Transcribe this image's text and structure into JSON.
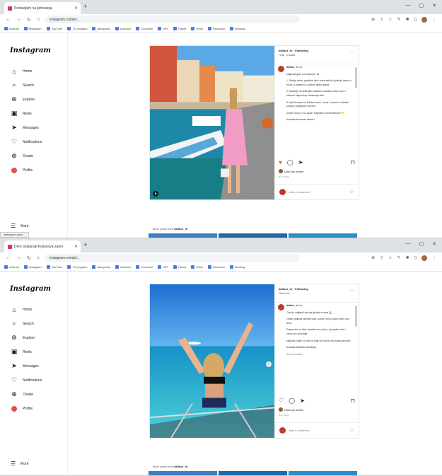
{
  "shots": [
    {
      "tab_title": "Postavljeni sa ljetovanja",
      "url": "instagram.com/p/...",
      "post": {
        "username": "dalibor_hr · Following",
        "location": "Hvar, Croatia",
        "caption_user": "dalibor_hr",
        "caption_time": "1w",
        "caption": [
          "Najljepši grad na Jadranu? 😍",
          "1. Šetnja rivom, gradske ulice pune kafića i jutarnja kava uz more, a posebno u starom dijelu grada.",
          "2. Kupanje na obližnjim plažama, kristalno čisto more i skriveni zaljevi koji oduzimaju dah.",
          "3. Izlet brodom na Pakleni otoci, ručak u konobi i zalazak sunca s pogledom na luku.",
          "Znate li koji je ovo grad? Napišite u komentarima! 👇",
          "#croatia #summer #travel"
        ],
        "likes": "Liked by others",
        "date": "JULY 2022",
        "comment_placeholder": "Add a comment..."
      },
      "more_posts_prefix": "More posts from",
      "more_posts_user": "dalibor_hr"
    },
    {
      "tab_title": "Dom postanak Kokosova zanni",
      "url": "instagram.com/p/...",
      "post": {
        "username": "dalibor_hr · Following",
        "location": "Otok Krk",
        "caption_user": "dalibor_hr",
        "caption_time": "1w",
        "caption": [
          "Otok je najljepši kad ga gledaš s mora 🌊",
          "Ovako izgleda savršen dan: sunce, brod i plavo more oko tebe.",
          "Preporuke za izlet: krenite rano ujutro, ponesite vodu i kremu za sunčanje.",
          "Najbolje uvale su one do kojih se može doći samo brodom.",
          "#croatia #adriatic #boatday",
          "See translation"
        ],
        "likes": "Liked by others",
        "date": "JULY 2022",
        "comment_placeholder": "Add a comment..."
      },
      "more_posts_prefix": "More posts from",
      "more_posts_user": "dalibor_hr"
    }
  ],
  "browser": {
    "new_tab": "+",
    "bookmarks": [
      "Android",
      "Instagram",
      "YouTube",
      "TV program",
      "Aliexpress",
      "Ulaznice",
      "Cromwell",
      "HRT",
      "Planet",
      "Hotel",
      "Facebook",
      "Booking"
    ]
  },
  "sidebar": {
    "logo": "Instagram",
    "items": [
      {
        "label": "Home",
        "icon": "home-icon",
        "glyph": "⌂"
      },
      {
        "label": "Search",
        "icon": "search-icon",
        "glyph": "⌕"
      },
      {
        "label": "Explore",
        "icon": "compass-icon",
        "glyph": "⊛"
      },
      {
        "label": "Reels",
        "icon": "reels-icon",
        "glyph": "▣"
      },
      {
        "label": "Messages",
        "icon": "send-icon",
        "glyph": "➤"
      },
      {
        "label": "Notifications",
        "icon": "heart-icon",
        "glyph": "♡"
      },
      {
        "label": "Create",
        "icon": "plus-icon",
        "glyph": "⊕"
      },
      {
        "label": "Profile",
        "icon": "avatar",
        "glyph": ""
      }
    ],
    "more_label": "More",
    "status_url": "instagram.com/..."
  }
}
